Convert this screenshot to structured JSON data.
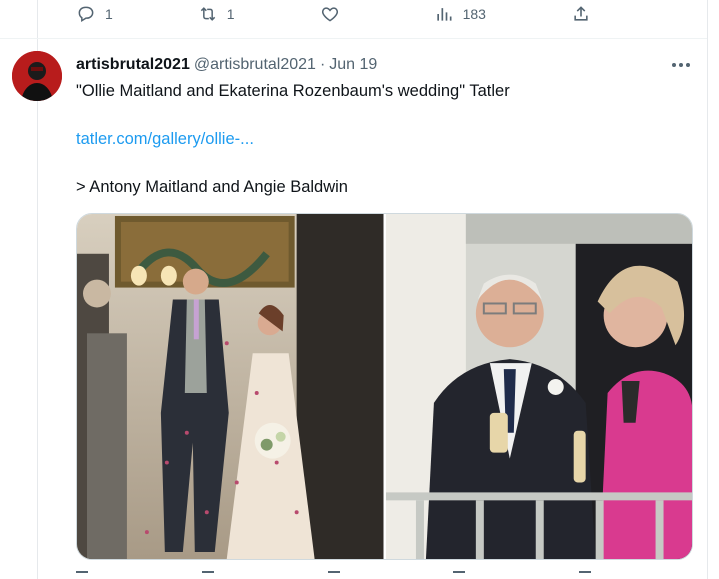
{
  "actions": {
    "reply": {
      "icon": "reply-icon",
      "count": "1"
    },
    "retweet": {
      "icon": "retweet-icon",
      "count": "1"
    },
    "like": {
      "icon": "heart-icon",
      "count": ""
    },
    "views": {
      "icon": "bar-chart-icon",
      "count": "183"
    },
    "share": {
      "icon": "share-icon"
    }
  },
  "tweet": {
    "display_name": "artisbrutal2021",
    "handle": "@artisbrutal2021",
    "separator": "·",
    "date": "Jun 19",
    "text": "\"Ollie Maitland and Ekaterina Rozenbaum's wedding\" Tatler",
    "link": "tatler.com/gallery/ollie-...",
    "attribution": "> Antony Maitland and Angie Baldwin"
  },
  "colors": {
    "link": "#1d9bf0",
    "muted": "#536471",
    "text": "#0f1419",
    "divider": "#eff3f4",
    "avatar": "#c21f1f",
    "pink_coat": "#d93a8f"
  },
  "media": {
    "photos": [
      {
        "name": "wedding-couple-photo"
      },
      {
        "name": "elderly-couple-photo"
      }
    ]
  }
}
